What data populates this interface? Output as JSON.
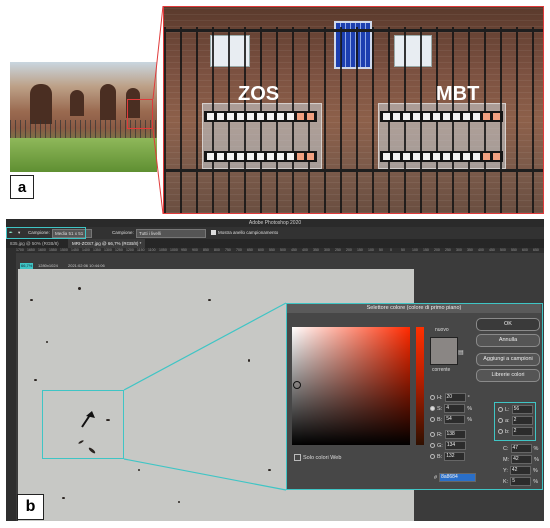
{
  "panel_a": {
    "label": "a",
    "left_group_label": "ZOS",
    "right_group_label": "MBT"
  },
  "panel_b": {
    "label": "b",
    "app_title": "Adobe Photoshop 2020",
    "options_bar": {
      "sample_size_label": "Campione:",
      "sample_size_value": "Media 51 x 51",
      "sample_label": "Campione:",
      "sample_value": "Tutti i livelli",
      "show_ring_label": "Mostra anello campionamento"
    },
    "tabs": [
      "835.jpg @ 50% (RGB/8)",
      "MRI-ZOS7.jpg @ 66,7% (RGB/8) *"
    ],
    "canvas_info": {
      "zoom": "66,7%",
      "doc_size": "1280x1024",
      "timestamp": "2021:02:06 10:44:06"
    },
    "ruler_marks": [
      "1700",
      "1650",
      "1600",
      "1550",
      "1500",
      "1450",
      "1400",
      "1350",
      "1300",
      "1250",
      "1200",
      "1150",
      "1100",
      "1050",
      "1000",
      "950",
      "900",
      "850",
      "800",
      "750",
      "700",
      "650",
      "600",
      "550",
      "500",
      "450",
      "400",
      "350",
      "300",
      "250",
      "200",
      "150",
      "100",
      "50",
      "0",
      "50",
      "100",
      "150",
      "200",
      "250",
      "300",
      "350",
      "400",
      "450",
      "500",
      "550",
      "600",
      "650",
      "700"
    ],
    "color_picker": {
      "title": "Selettore colore (colore di primo piano)",
      "new_label": "nuovo",
      "current_label": "corrente",
      "buttons": {
        "ok": "OK",
        "cancel": "Annulla",
        "add_to_swatches": "Aggiungi a campioni",
        "color_libraries": "Librerie colori"
      },
      "web_only_label": "Solo colori Web",
      "hsb": {
        "h_label": "H:",
        "h_value": "20",
        "h_unit": "°",
        "s_label": "S:",
        "s_value": "4",
        "s_unit": "%",
        "b_label": "B:",
        "b_value": "54",
        "b_unit": "%"
      },
      "rgb": {
        "r_label": "R:",
        "r_value": "138",
        "g_label": "G:",
        "g_value": "134",
        "b_label": "B:",
        "b_value": "132"
      },
      "lab": {
        "l_label": "L:",
        "l_value": "56",
        "a_label": "a:",
        "a_value": "2",
        "b_label": "b:",
        "b_value": "2"
      },
      "cmyk": {
        "c_label": "C:",
        "c_value": "47",
        "c_unit": "%",
        "m_label": "M:",
        "m_value": "42",
        "m_unit": "%",
        "y_label": "Y:",
        "y_value": "42",
        "y_unit": "%",
        "k_label": "K:",
        "k_value": "5",
        "k_unit": "%"
      },
      "hex_label": "#",
      "hex_value": "8a8684",
      "picked_color": "#8a8684"
    },
    "highlight_color": "#3fc5c5"
  },
  "panel_a_highlight_color": "#e03a3a"
}
